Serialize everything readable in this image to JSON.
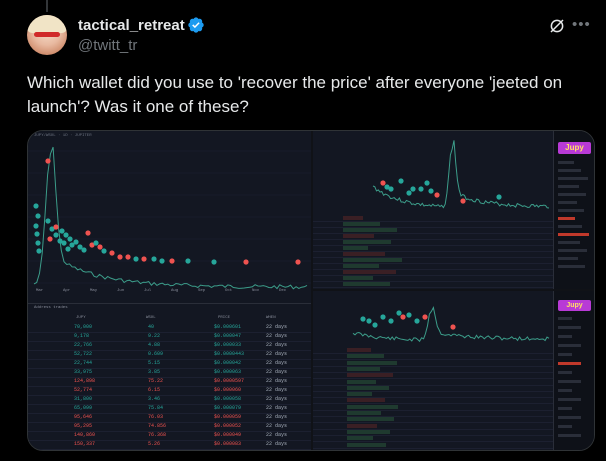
{
  "tweet": {
    "display_name": "tactical_retreat",
    "handle": "@twitt_tr",
    "text": "Which wallet did you use to 'recover the price' after everyone 'jeeted on launch'? Was it one of these?"
  },
  "icons": {
    "verified": "verified-badge-icon",
    "grok": "grok-icon",
    "more": "more-options-icon"
  },
  "colors": {
    "accent": "#1d9bf0",
    "buy": "#26a69a",
    "sell": "#ef5350",
    "chart_line": "#3c9d8a",
    "jupy_brand": "#b83ad6"
  },
  "media": {
    "chart_a_months": [
      "Mar",
      "Apr",
      "May",
      "Jun",
      "Jul",
      "Aug",
      "Sep",
      "Oct",
      "Nov",
      "Dec"
    ],
    "jupy_label": "Jupy",
    "table_headers": [
      "JUPY",
      "WSOL",
      "PRICE",
      "WHEN"
    ],
    "table_jupy": [
      "70,000",
      "9,178",
      "22,766",
      "52,722",
      "22,744",
      "33,975",
      "124,898",
      "52,774",
      "31,800",
      "65,099",
      "95,646",
      "95,295",
      "140,860",
      "150,337"
    ],
    "table_wsol": [
      "40",
      "9.22",
      "4.88",
      "0.609",
      "5.15",
      "3.85",
      "75.22",
      "6.15",
      "3.46",
      "75.84",
      "76.03",
      "74.856",
      "76.368",
      "5.26"
    ],
    "table_price": [
      "$0.000601",
      "$0.000047",
      "$0.000033",
      "$0.0000443",
      "$0.000042",
      "$0.000063",
      "$0.0000597",
      "$0.000060",
      "$0.000058",
      "$0.000079",
      "$0.000059",
      "$0.000052",
      "$0.000049",
      "$0.000083"
    ],
    "table_when": [
      "22 days",
      "22 days",
      "22 days",
      "22 days",
      "22 days",
      "22 days",
      "22 days",
      "22 days",
      "22 days",
      "22 days",
      "22 days",
      "22 days",
      "22 days",
      "22 days"
    ]
  }
}
